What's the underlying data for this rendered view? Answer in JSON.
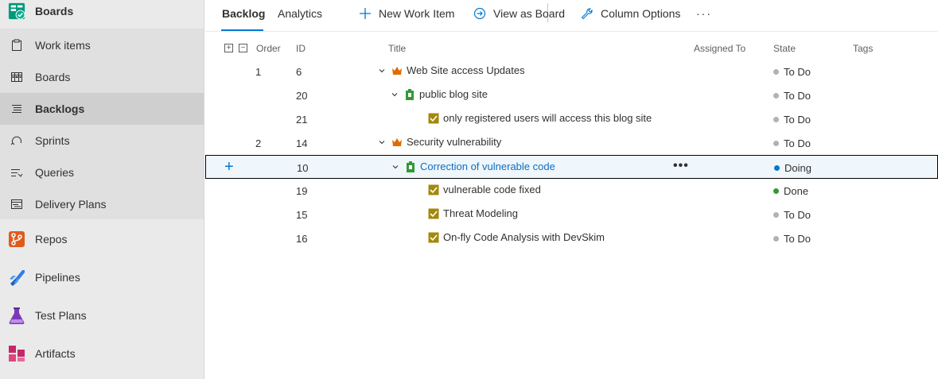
{
  "sidebar": {
    "header": {
      "label": "Boards",
      "icon": "boards-hub-icon"
    },
    "sub_items": [
      {
        "label": "Work items",
        "icon": "work-items-icon"
      },
      {
        "label": "Boards",
        "icon": "boards-icon"
      },
      {
        "label": "Backlogs",
        "icon": "backlogs-icon",
        "selected": true
      },
      {
        "label": "Sprints",
        "icon": "sprints-icon"
      },
      {
        "label": "Queries",
        "icon": "queries-icon"
      },
      {
        "label": "Delivery Plans",
        "icon": "delivery-plans-icon"
      }
    ],
    "hubs": [
      {
        "label": "Repos",
        "icon": "repos-icon"
      },
      {
        "label": "Pipelines",
        "icon": "pipelines-icon"
      },
      {
        "label": "Test Plans",
        "icon": "test-plans-icon"
      },
      {
        "label": "Artifacts",
        "icon": "artifacts-icon"
      }
    ]
  },
  "toolbar": {
    "tab_backlog": "Backlog",
    "tab_analytics": "Analytics",
    "new_work_item": "New Work Item",
    "view_as_board": "View as Board",
    "column_options": "Column Options",
    "more": "···"
  },
  "grid": {
    "expand_all": "+",
    "collapse_all": "−",
    "headers": {
      "order": "Order",
      "id": "ID",
      "title": "Title",
      "assigned_to": "Assigned To",
      "state": "State",
      "tags": "Tags"
    },
    "rows": [
      {
        "order": "1",
        "id": "6",
        "title": "Web Site access Updates",
        "type": "epic",
        "level": 0,
        "expandable": true,
        "state": "To Do",
        "state_color": "#b2b2b2"
      },
      {
        "order": "",
        "id": "20",
        "title": "public blog site",
        "type": "feature",
        "level": 1,
        "expandable": true,
        "state": "To Do",
        "state_color": "#b2b2b2"
      },
      {
        "order": "",
        "id": "21",
        "title": "only registered users will access this blog site",
        "type": "task",
        "level": 2,
        "expandable": false,
        "state": "To Do",
        "state_color": "#b2b2b2"
      },
      {
        "order": "2",
        "id": "14",
        "title": "Security vulnerability",
        "type": "epic",
        "level": 0,
        "expandable": true,
        "state": "To Do",
        "state_color": "#b2b2b2"
      },
      {
        "order": "",
        "id": "10",
        "title": "Correction of vulnerable code",
        "type": "feature",
        "level": 1,
        "expandable": true,
        "state": "Doing",
        "state_color": "#007acc",
        "selected": true
      },
      {
        "order": "",
        "id": "19",
        "title": "vulnerable code fixed",
        "type": "task",
        "level": 2,
        "expandable": false,
        "state": "Done",
        "state_color": "#339933"
      },
      {
        "order": "",
        "id": "15",
        "title": "Threat Modeling",
        "type": "task",
        "level": 2,
        "expandable": false,
        "state": "To Do",
        "state_color": "#b2b2b2"
      },
      {
        "order": "",
        "id": "16",
        "title": "On-fly Code Analysis with DevSkim",
        "type": "task",
        "level": 2,
        "expandable": false,
        "state": "To Do",
        "state_color": "#b2b2b2"
      }
    ],
    "row_more": "•••",
    "row_add": "+"
  },
  "colors": {
    "accent": "#0078d4",
    "epic": "#e06c00",
    "feature": "#339933",
    "task": "#a4880a"
  }
}
